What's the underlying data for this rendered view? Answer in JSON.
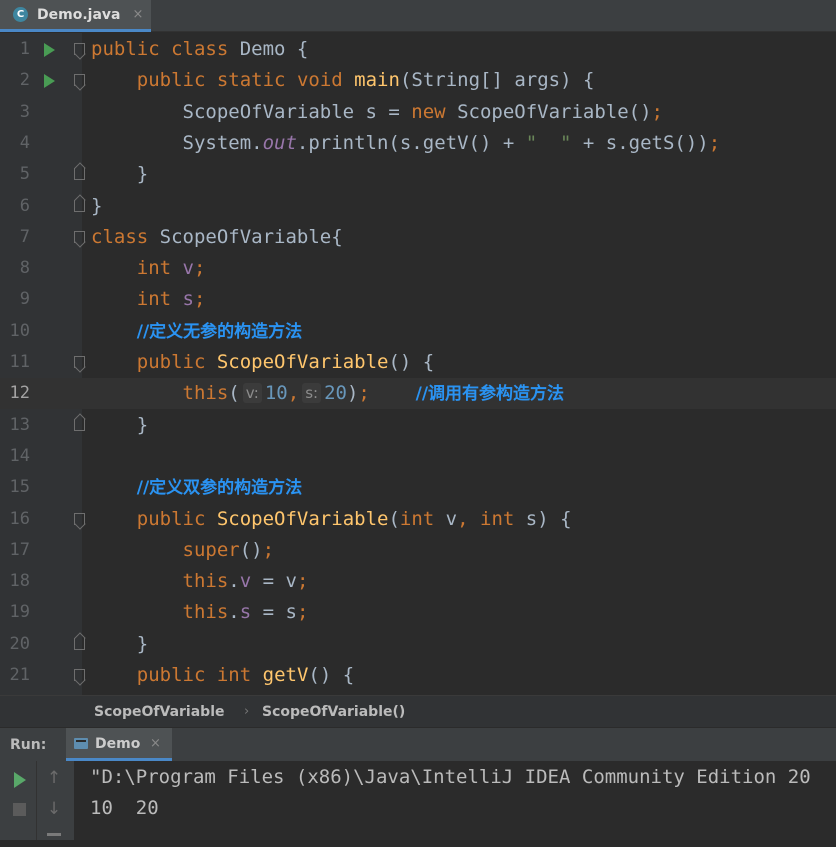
{
  "tab": {
    "icon": "C",
    "label": "Demo.java",
    "close": "×"
  },
  "editor": {
    "current_line": 12,
    "lines": [
      {
        "n": "1",
        "run": true,
        "fold": "open"
      },
      {
        "n": "2",
        "run": true,
        "fold": "open"
      },
      {
        "n": "3",
        "run": false,
        "fold": ""
      },
      {
        "n": "4",
        "run": false,
        "fold": ""
      },
      {
        "n": "5",
        "run": false,
        "fold": "close"
      },
      {
        "n": "6",
        "run": false,
        "fold": "close"
      },
      {
        "n": "7",
        "run": false,
        "fold": "open"
      },
      {
        "n": "8",
        "run": false,
        "fold": ""
      },
      {
        "n": "9",
        "run": false,
        "fold": ""
      },
      {
        "n": "10",
        "run": false,
        "fold": ""
      },
      {
        "n": "11",
        "run": false,
        "fold": "open"
      },
      {
        "n": "12",
        "run": false,
        "fold": ""
      },
      {
        "n": "13",
        "run": false,
        "fold": "close"
      },
      {
        "n": "14",
        "run": false,
        "fold": ""
      },
      {
        "n": "15",
        "run": false,
        "fold": ""
      },
      {
        "n": "16",
        "run": false,
        "fold": "open"
      },
      {
        "n": "17",
        "run": false,
        "fold": ""
      },
      {
        "n": "18",
        "run": false,
        "fold": ""
      },
      {
        "n": "19",
        "run": false,
        "fold": ""
      },
      {
        "n": "20",
        "run": false,
        "fold": "close"
      },
      {
        "n": "21",
        "run": false,
        "fold": "open"
      }
    ],
    "code": {
      "l1": [
        "public",
        " ",
        "class",
        " Demo {"
      ],
      "l2": [
        "    ",
        "public",
        " ",
        "static",
        " ",
        "void",
        " ",
        "main",
        "(String[] args) {"
      ],
      "l3": [
        "        ScopeOfVariable s = ",
        "new",
        " ScopeOfVariable()",
        ";"
      ],
      "l4": [
        "        System.",
        "out",
        ".println(s.getV() + ",
        "\"  \"",
        " + s.getS())",
        ";"
      ],
      "l5": [
        "    }"
      ],
      "l6": [
        "}"
      ],
      "l7": [
        "class",
        " ScopeOfVariable{"
      ],
      "l8": [
        "    ",
        "int",
        " ",
        "v",
        ";"
      ],
      "l9": [
        "    ",
        "int",
        " ",
        "s",
        ";"
      ],
      "l10": [
        "    ",
        "//定义无参的构造方法"
      ],
      "l11": [
        "    ",
        "public",
        " ",
        "ScopeOfVariable",
        "() {"
      ],
      "l12": [
        "        ",
        "this",
        "(",
        "v:",
        "10",
        ",",
        "s:",
        "20",
        ")",
        ";",
        "    ",
        "//调用有参构造方法"
      ],
      "l13": [
        "    }"
      ],
      "l14": [
        ""
      ],
      "l15": [
        "    ",
        "//定义双参的构造方法"
      ],
      "l16": [
        "    ",
        "public",
        " ",
        "ScopeOfVariable",
        "(",
        "int",
        " v",
        ",",
        " ",
        "int",
        " s) {"
      ],
      "l17": [
        "        ",
        "super",
        "()",
        ";"
      ],
      "l18": [
        "        ",
        "this",
        ".",
        "v",
        " = v",
        ";"
      ],
      "l19": [
        "        ",
        "this",
        ".",
        "s",
        " = s",
        ";"
      ],
      "l20": [
        "    }"
      ],
      "l21": [
        "    ",
        "public",
        " ",
        "int",
        " ",
        "getV",
        "() {"
      ]
    }
  },
  "breadcrumb": {
    "items": [
      "ScopeOfVariable",
      "ScopeOfVariable()"
    ],
    "separator": "›"
  },
  "run_panel": {
    "label": "Run:",
    "tab_label": "Demo",
    "tab_close": "×",
    "tools": [
      "rerun-icon",
      "stop-icon",
      "up-icon",
      "down-icon",
      "wrap-icon"
    ],
    "up_glyph": "↑",
    "down_glyph": "↓",
    "output": [
      "\"D:\\Program Files (x86)\\Java\\IntelliJ IDEA Community Edition 20",
      "10  20"
    ]
  }
}
